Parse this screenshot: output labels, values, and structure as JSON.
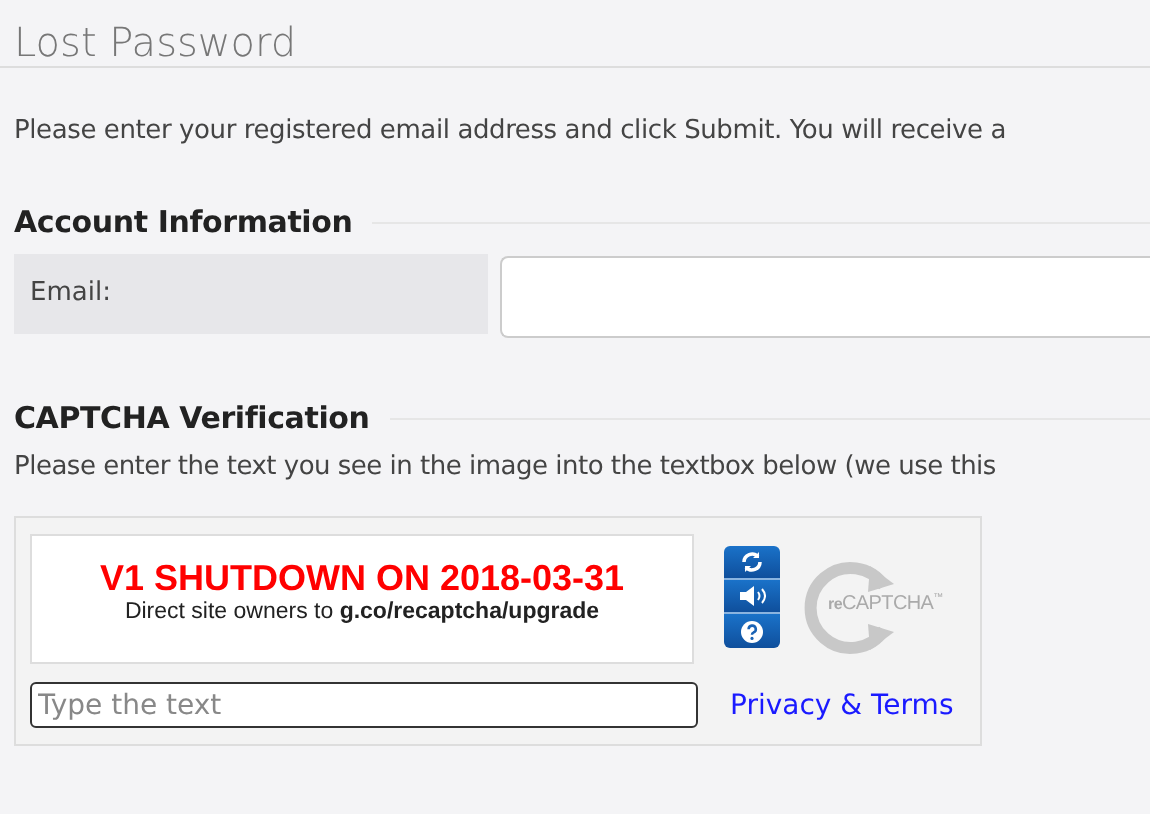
{
  "page": {
    "title": "Lost Password",
    "intro": "Please enter your registered email address and click Submit. You will receive a"
  },
  "account": {
    "heading": "Account Information",
    "email_label": "Email:"
  },
  "captcha": {
    "heading": "CAPTCHA Verification",
    "instructions": "Please enter the text you see in the image into the textbox below (we use this",
    "image_title": "V1 SHUTDOWN ON 2018-03-31",
    "image_subtitle": "Direct site owners to **g.co/recaptcha/upgrade**",
    "logo_prefix": "re",
    "logo_text": "CAPTCHA",
    "logo_tm": "™",
    "input_placeholder": "Type the text",
    "link": "Privacy & Terms"
  }
}
